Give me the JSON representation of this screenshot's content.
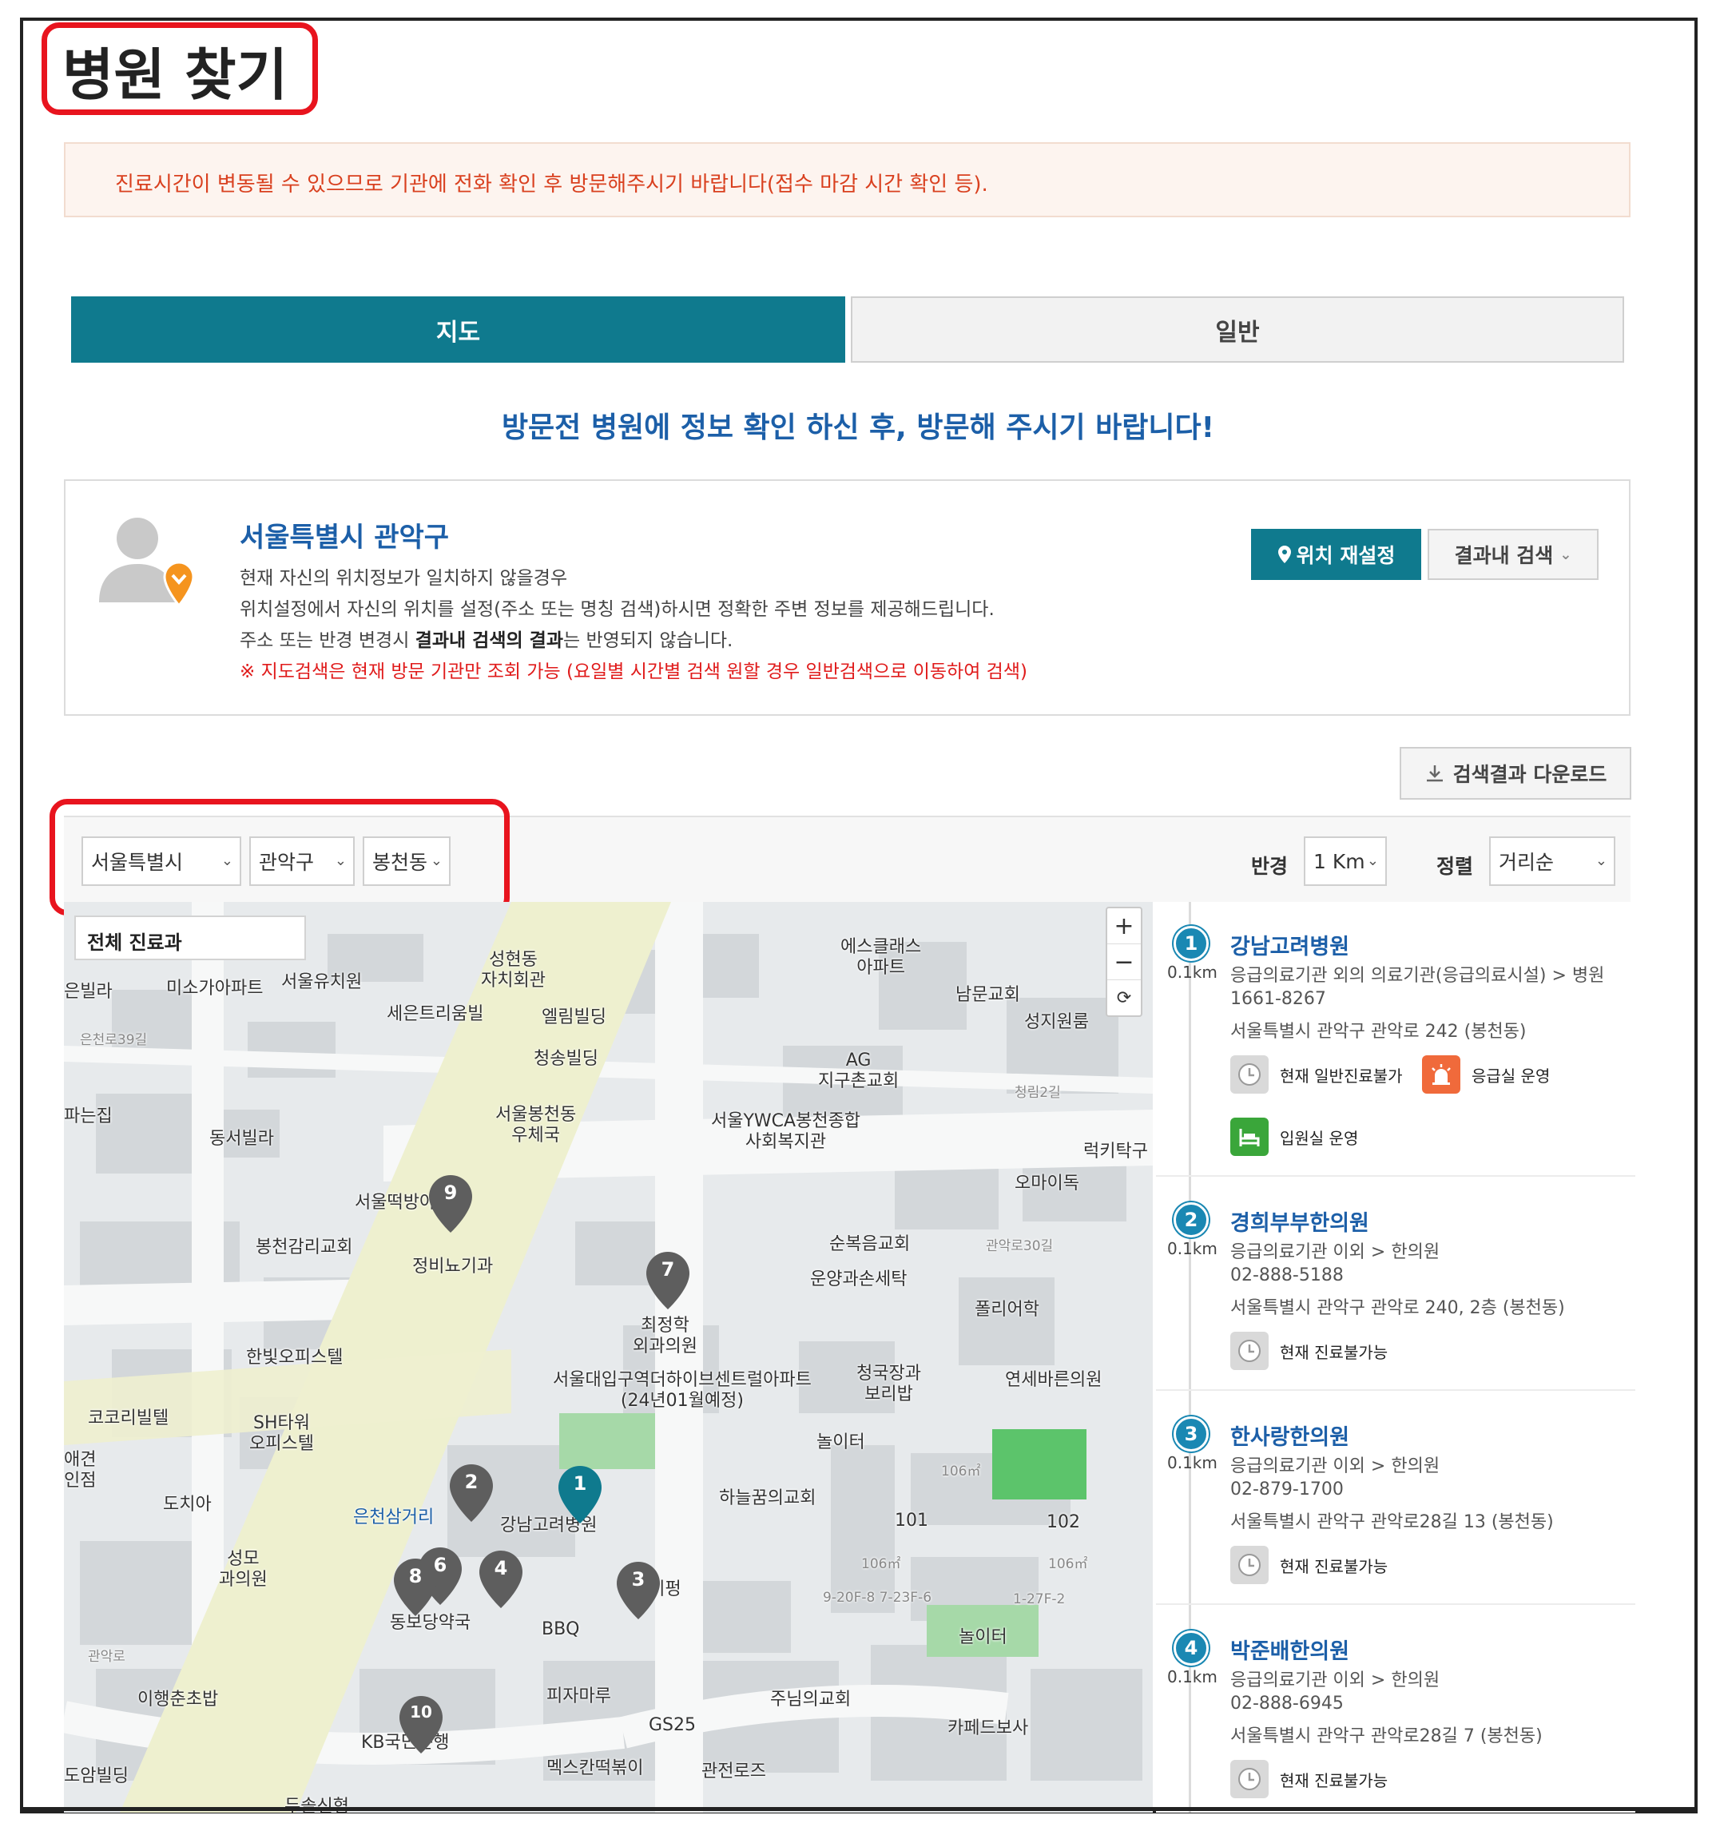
{
  "page": {
    "title": "병원 찾기"
  },
  "notice": {
    "text": "진료시간이 변동될 수 있으므로 기관에 전화 확인 후 방문해주시기 바랍니다(접수 마감 시간 확인 등)."
  },
  "tabs": {
    "map": "지도",
    "general": "일반"
  },
  "headline": "방문전 병원에 정보 확인 하신 후, 방문해 주시기 바랍니다!",
  "location": {
    "name": "서울특별시 관악구",
    "line1": "현재 자신의 위치정보가 일치하지 않을경우",
    "line2": "위치설정에서 자신의 위치를 설정(주소 또는 명칭 검색)하시면 정확한 주변 정보를 제공해드립니다.",
    "line3_pre": "주소 또는 반경 변경시 ",
    "line3_bold": "결과내 검색의 결과",
    "line3_post": "는 반영되지 않습니다.",
    "warning": "※ 지도검색은 현재 방문 기관만 조회 가능 (요일별 시간별 검색 원할 경우 일반검색으로 이동하여 검색)",
    "reset_label": "위치 재설정",
    "filter_label": "결과내 검색"
  },
  "download_label": "검색결과 다운로드",
  "filters": {
    "city": "서울특별시",
    "district": "관악구",
    "dong": "봉천동",
    "radius_label": "반경",
    "radius": "1 Km",
    "sort_label": "정렬",
    "sort": "거리순"
  },
  "map": {
    "dept_label": "전체 진료과",
    "zoom_in": "+",
    "zoom_out": "−",
    "refresh": "⟳",
    "labels": {
      "l1": "서울유치원",
      "l2": "미소가아파트",
      "l3": "은빌라",
      "l4": "성현동\n자치회관",
      "l5": "세은트리움빌",
      "l6": "엘림빌딩",
      "l7": "청송빌딩",
      "l8": "서울봉천동\n우체국",
      "l9": "에스클래스\n아파트",
      "l10": "남문교회",
      "l11": "성지원룸",
      "l12": "AG\n지구촌교회",
      "l13": "서울YWCA봉천종합\n사회복지관",
      "l14": "파는집",
      "l15": "동서빌라",
      "l16": "서울떡방아",
      "l17": "봉천감리교회",
      "l18": "정비뇨기과",
      "l19": "오마이독",
      "l20": "럭키탁구",
      "l21": "순복음교회",
      "l22": "운양과손세탁",
      "l23": "폴리어학",
      "l24": "최정학\n외과의원",
      "l25": "연세바른의원",
      "l26": "한빛오피스텔",
      "l27": "서울대입구역더하이브센트럴아파트\n(24년01월예정)",
      "l28": "청국장과\n보리밥",
      "l29": "코코리빌텔",
      "l30": "SH타워\n오피스텔",
      "l31": "놀이터",
      "l32": "하늘꿈의교회",
      "l33": "애견\n인점",
      "l34": "도치아",
      "l35": "은천삼거리",
      "l36": "강남고려병원",
      "l37": "101",
      "l38": "102",
      "l39": "성모\n과의원",
      "l40": "타이펑",
      "l41": "동보당약국",
      "l42": "BBQ",
      "l43": "놀이터",
      "l44": "이행춘초밥",
      "l45": "피자마루",
      "l46": "GS25",
      "l47": "주님의교회",
      "l48": "카페드보사",
      "l49": "KB국민은행",
      "l50": "멕스칸떡볶이",
      "l51": "관전로즈",
      "l52": "도암빌딩",
      "l53": "두솔신협",
      "l54": "106㎡",
      "l55": "106㎡",
      "l56": "106㎡",
      "l57": "9-20F-8 7-23F-6",
      "l58": "1-27F-2",
      "l59": "은천로39길",
      "l60": "관악로30길",
      "l61": "청림2길",
      "l62": "관악로"
    },
    "pins": [
      "1",
      "2",
      "3",
      "4",
      "6",
      "7",
      "8",
      "9",
      "10"
    ]
  },
  "results": [
    {
      "index": "1",
      "distance": "0.1km",
      "name": "강남고려병원",
      "category": "응급의료기관 외의 의료기관(응급의료시설) > 병원",
      "phone": "1661-8267",
      "address": "서울특별시 관악구 관악로 242 (봉천동)",
      "badges": [
        "현재 일반진료불가",
        "응급실 운영",
        "입원실 운영"
      ]
    },
    {
      "index": "2",
      "distance": "0.1km",
      "name": "경희부부한의원",
      "category": "응급의료기관 이외 > 한의원",
      "phone": "02-888-5188",
      "address": "서울특별시 관악구 관악로 240, 2층 (봉천동)",
      "badges": [
        "현재 진료불가능"
      ]
    },
    {
      "index": "3",
      "distance": "0.1km",
      "name": "한사랑한의원",
      "category": "응급의료기관 이외 > 한의원",
      "phone": "02-879-1700",
      "address": "서울특별시 관악구 관악로28길 13 (봉천동)",
      "badges": [
        "현재 진료불가능"
      ]
    },
    {
      "index": "4",
      "distance": "0.1km",
      "name": "박준배한의원",
      "category": "응급의료기관 이외 > 한의원",
      "phone": "02-888-6945",
      "address": "서울특별시 관악구 관악로28길 7 (봉천동)",
      "badges": [
        "현재 진료불가능"
      ]
    }
  ],
  "colors": {
    "accent": "#0f7a8e",
    "link": "#1c5fa8",
    "warning": "#e01b1b",
    "highlight": "#e8141e"
  }
}
